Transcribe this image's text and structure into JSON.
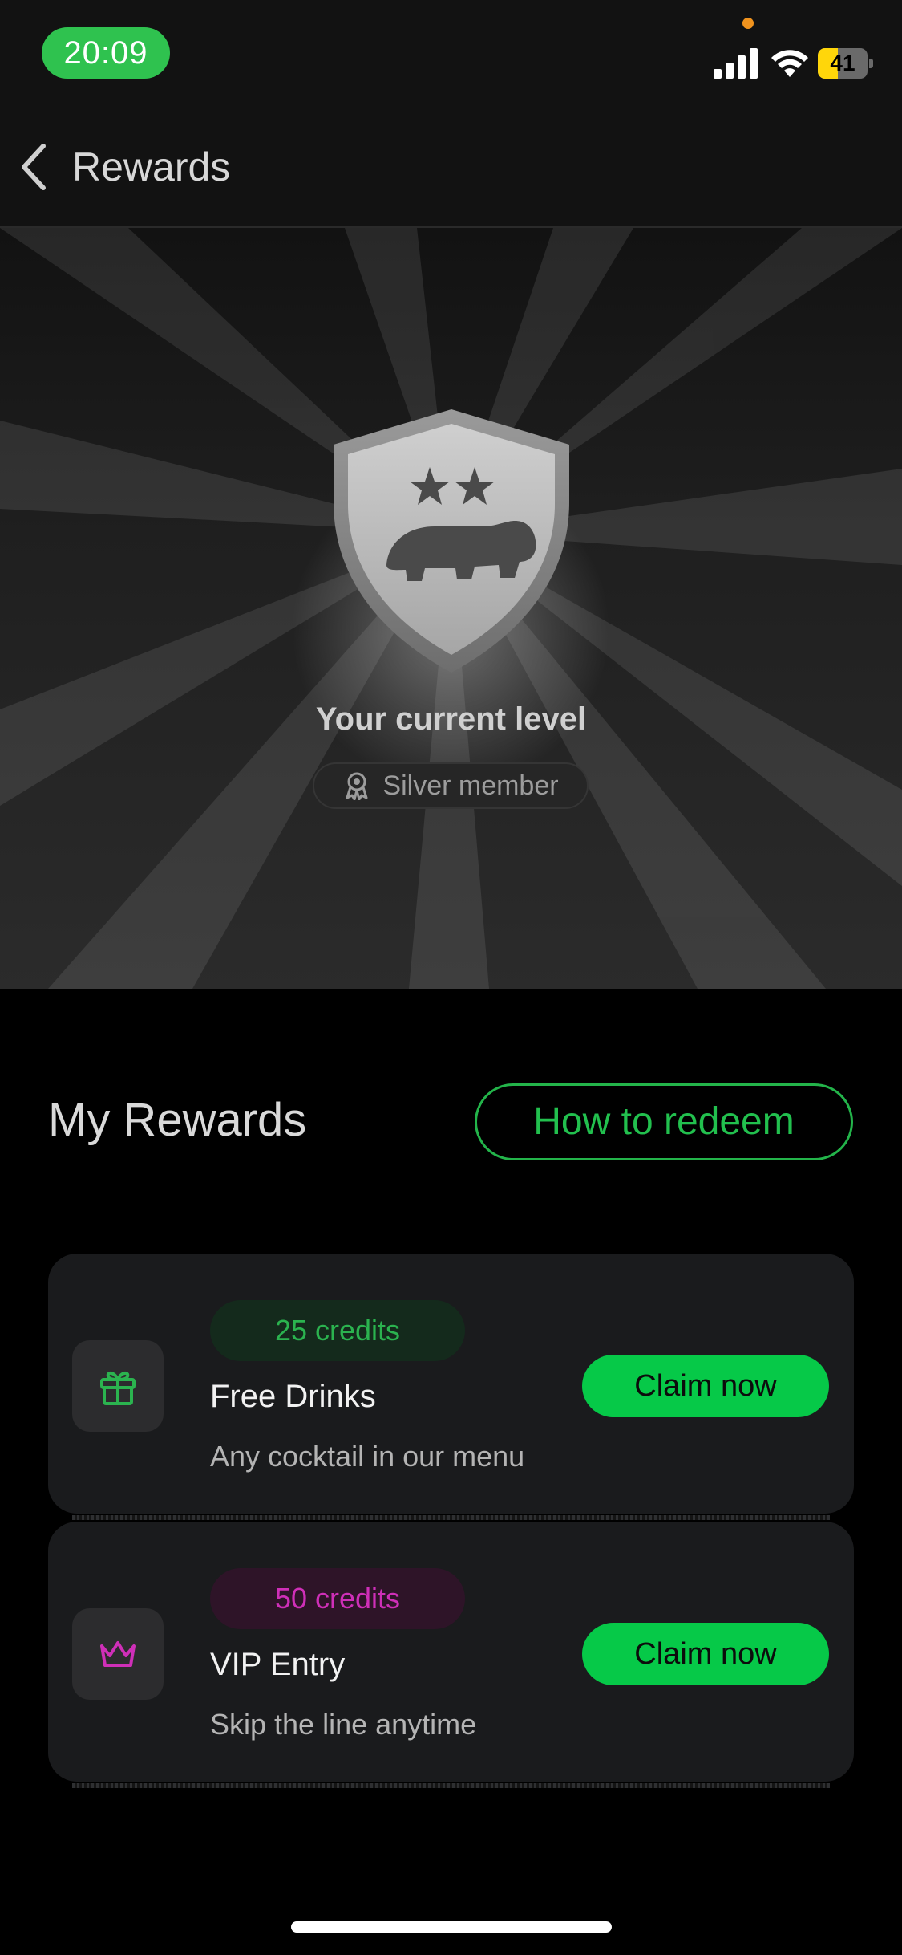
{
  "status_bar": {
    "time": "20:09",
    "battery_level": "41",
    "battery_charge_fraction": 0.41,
    "signal_icon": "cellular-signal-icon",
    "wifi_icon": "wifi-icon"
  },
  "nav": {
    "back_icon": "chevron-left-icon",
    "title": "Rewards"
  },
  "hero": {
    "emblem_icon": "shield-hippo-icon",
    "level_title": "Your current level",
    "level_badge_icon": "award-icon",
    "level_name": "Silver member"
  },
  "rewards_section": {
    "title": "My Rewards",
    "redeem_label": "How to redeem",
    "items": [
      {
        "credits": "25 credits",
        "title": "Free Drinks",
        "description": "Any cocktail in our menu",
        "icon": "gift-icon",
        "accent_color": "#2bb34f",
        "claim_label": "Claim now"
      },
      {
        "credits": "50 credits",
        "title": "VIP Entry",
        "description": "Skip the line anytime",
        "icon": "crown-icon",
        "accent_color": "#cf2fb8",
        "claim_label": "Claim now"
      }
    ]
  },
  "colors": {
    "primary_green": "#06c948",
    "outline_green": "#23b44a",
    "status_time_green": "#2fc24f",
    "battery_yellow": "#ffd60a",
    "vip_pink": "#cf2fb8"
  }
}
